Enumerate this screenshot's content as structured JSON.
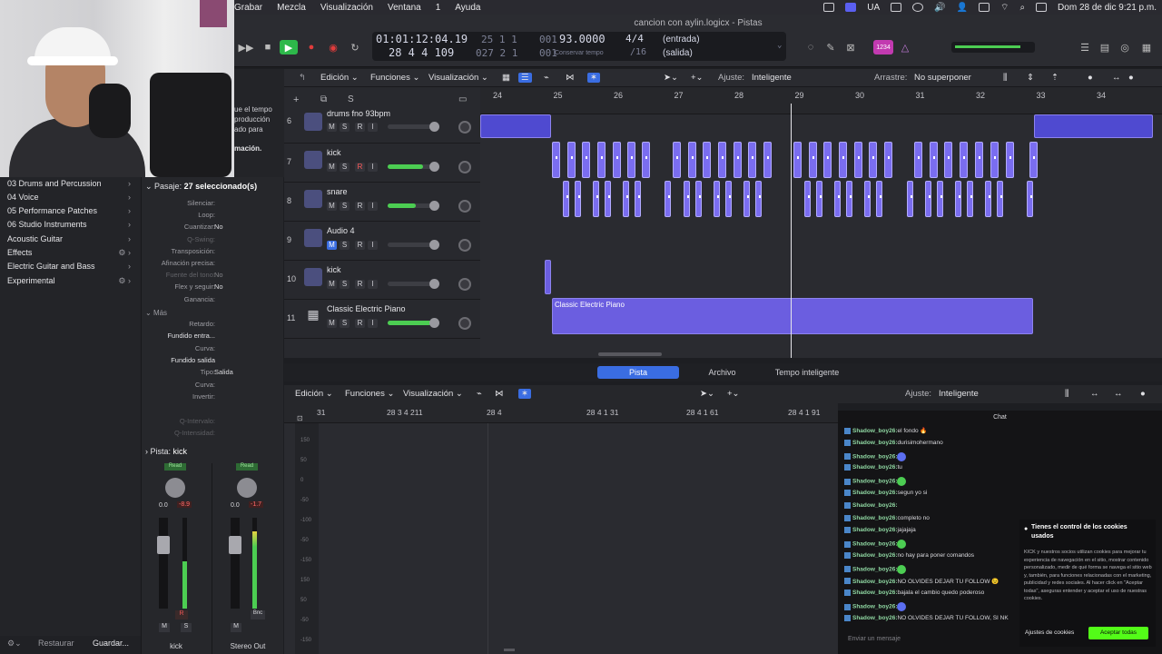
{
  "menubar": {
    "items": [
      "Grabar",
      "Mezcla",
      "Visualización",
      "Ventana",
      "1",
      "Ayuda"
    ],
    "status_lang": "UA",
    "datetime": "Dom 28 de dic  9:21 p.m."
  },
  "title": "cancion con aylin.logicx - Pistas",
  "lcd": {
    "smpte": "01:01:12:04.19",
    "smpte_sub": "25  1  1",
    "smpte_sub2": "001",
    "bars": "28  4  4  109",
    "bars_sub": "027  2  1",
    "bars_sub2": "001",
    "tempo": "93.0000",
    "tempo_label": "Conservar tempo",
    "sig": "4/4",
    "div": "/16",
    "in": "(entrada)",
    "out": "(salida)"
  },
  "control_bar": {
    "count_in": "1234"
  },
  "library": {
    "items": [
      {
        "label": "03 Drums and Percussion",
        "gear": false
      },
      {
        "label": "04 Voice",
        "gear": false
      },
      {
        "label": "05 Performance Patches",
        "gear": false
      },
      {
        "label": "06 Studio Instruments",
        "gear": false
      },
      {
        "label": "Acoustic Guitar",
        "gear": false
      },
      {
        "label": "Effects",
        "gear": true
      },
      {
        "label": "Electric Guitar and Bass",
        "gear": false
      },
      {
        "label": "Experimental",
        "gear": true
      }
    ],
    "restore": "Restaurar",
    "save": "Guardar..."
  },
  "partial_text": {
    "line1": "ue el tempo",
    "line2": "producción",
    "line3": "ado para",
    "line4": "mación."
  },
  "inspector": {
    "region_header": "Pasaje:",
    "region_count": "27 seleccionado(s)",
    "rows": [
      {
        "label": "Silenciar:",
        "value": ""
      },
      {
        "label": "Loop:",
        "value": ""
      },
      {
        "label": "Cuantizar:",
        "value": "No"
      },
      {
        "label": "Q-Swing:",
        "value": ""
      },
      {
        "label": "Transposición:",
        "value": ""
      },
      {
        "label": "Afinación precisa:",
        "value": ""
      },
      {
        "label": "Fuente del tono:",
        "value": "No"
      },
      {
        "label": "Flex y seguir:",
        "value": "No"
      },
      {
        "label": "Ganancia:",
        "value": ""
      }
    ],
    "more": "Más",
    "rows2": [
      {
        "label": "Retardo:",
        "value": ""
      },
      {
        "label": "Fundido entra...",
        "value": ""
      },
      {
        "label": "Curva:",
        "value": ""
      },
      {
        "label": "Fundido salida",
        "value": ""
      },
      {
        "label": "Tipo:",
        "value": "Salida"
      },
      {
        "label": "Curva:",
        "value": ""
      },
      {
        "label": "Invertir:",
        "value": ""
      }
    ],
    "rows3": [
      {
        "label": "Q-Intervalo:",
        "value": ""
      },
      {
        "label": "Q-Intensidad:",
        "value": ""
      }
    ],
    "track_header": "Pista:",
    "track_name": "kick"
  },
  "strips": [
    {
      "name": "kick",
      "read": "Read",
      "vol": "0.0",
      "peak": "-8.9",
      "btn1": "M",
      "btn2": "S"
    },
    {
      "name": "Stereo Out",
      "read": "Read",
      "vol": "0.0",
      "peak": "-1.7",
      "btn1": "M",
      "btn2": "Bnc"
    }
  ],
  "tracks_toolbar": {
    "edicion": "Edición",
    "funciones": "Funciones",
    "visualizacion": "Visualización",
    "ajuste_label": "Ajuste:",
    "ajuste_value": "Inteligente",
    "arrastre_label": "Arrastre:",
    "arrastre_value": "No superponer"
  },
  "tracks": [
    {
      "num": "6",
      "name": "drums fno 93bpm",
      "fader": 0.0
    },
    {
      "num": "7",
      "name": "kick",
      "fader": 0.7
    },
    {
      "num": "8",
      "name": "snare",
      "fader": 0.55
    },
    {
      "num": "9",
      "name": "Audio 4",
      "fader": 0.0
    },
    {
      "num": "10",
      "name": "kick",
      "fader": 0.0
    },
    {
      "num": "11",
      "name": "Classic Electric Piano",
      "fader": 0.85
    }
  ],
  "track_buttons": [
    "M",
    "S",
    "R",
    "I"
  ],
  "ruler_bars": [
    "24",
    "25",
    "26",
    "27",
    "28",
    "29",
    "30",
    "31",
    "32",
    "33",
    "34"
  ],
  "regions": {
    "piano_label": "Classic Electric Piano"
  },
  "editor_tabs": [
    "Pista",
    "Archivo",
    "Tempo inteligente"
  ],
  "editor_toolbar": {
    "edicion": "Edición",
    "funciones": "Funciones",
    "visualizacion": "Visualización",
    "ajuste_label": "Ajuste:",
    "ajuste_value": "Inteligente"
  },
  "editor_ruler": [
    "31",
    "28 3 4 211",
    "28 4",
    "28 4 1 31",
    "28 4 1 61",
    "28 4 1 91"
  ],
  "editor_y": [
    "150",
    "50",
    "0",
    "-50",
    "-100",
    "-50",
    "-150",
    "150",
    "50",
    "-50",
    "-150"
  ],
  "chat": {
    "title": "Chat",
    "messages": [
      {
        "user": "Shadow_boy26:",
        "text": "el fondo 🔥"
      },
      {
        "user": "Shadow_boy26:",
        "text": "durisimohermano"
      },
      {
        "user": "Shadow_boy26:",
        "text": ""
      },
      {
        "user": "Shadow_boy26:",
        "text": "tu"
      },
      {
        "user": "Shadow_boy26:",
        "text": ""
      },
      {
        "user": "Shadow_boy26:",
        "text": "segun yo si"
      },
      {
        "user": "Shadow_boy26:",
        "text": ""
      },
      {
        "user": "Shadow_boy26:",
        "text": "completo no"
      },
      {
        "user": "Shadow_boy26:",
        "text": "jajajaja"
      },
      {
        "user": "Shadow_boy26:",
        "text": ""
      },
      {
        "user": "Shadow_boy26:",
        "text": "no hay para poner comandos"
      },
      {
        "user": "Shadow_boy26:",
        "text": ""
      },
      {
        "user": "Shadow_boy26:",
        "text": "NO OLVIDES DEJAR TU FOLLOW 😉"
      },
      {
        "user": "Shadow_boy26:",
        "text": "bajala el cambio quedo poderoso"
      },
      {
        "user": "Shadow_boy26:",
        "text": ""
      },
      {
        "user": "Shadow_boy26:",
        "text": "NO OLVIDES DEJAR TU FOLLOW, SI NK"
      }
    ],
    "input_placeholder": "Enviar un mensaje"
  },
  "cookie": {
    "title": "Tienes el control de los cookies usados",
    "body": "KICK y nuestros socios utilizan cookies para mejorar tu experiencia de navegación en el sitio, mostrar contenido personalizado, medir de qué forma se navega el sitio web y, también, para funciones relacionadas con el marketing, publicidad y redes sociales. Al hacer click en \"Aceptar todas\", aseguras entender y aceptar el uso de nuestras cookies.",
    "settings": "Ajustes de cookies",
    "accept": "Aceptar todas"
  },
  "colors": {
    "accent": "#5a5ff0",
    "region": "#6b5ee0",
    "play": "#2db84a",
    "kick_green": "#53fc18"
  }
}
